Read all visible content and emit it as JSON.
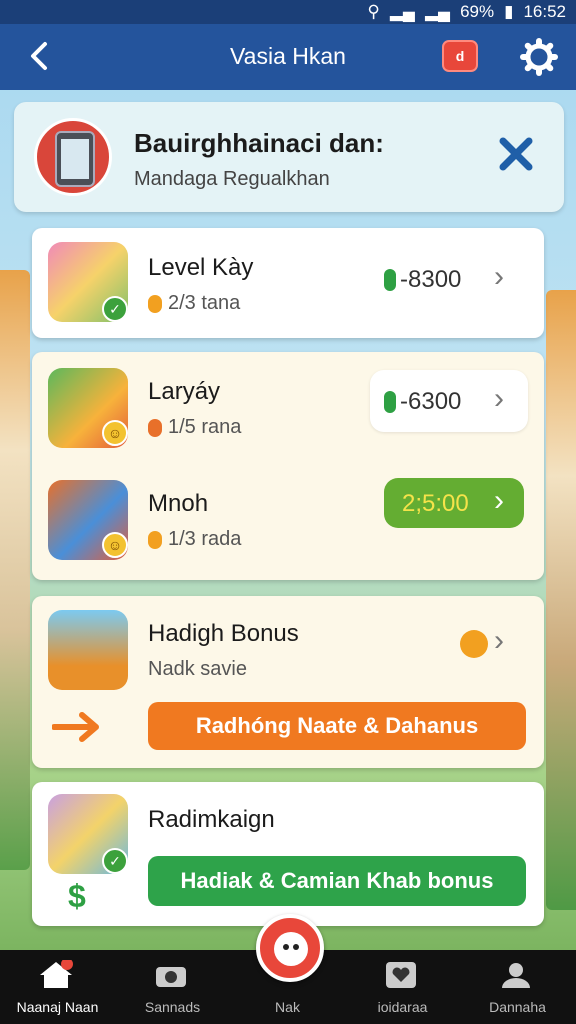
{
  "status_bar": {
    "battery": "69%",
    "time": "16:52"
  },
  "app_bar": {
    "title": "Vasia Hkan",
    "notification_badge": "d"
  },
  "header": {
    "title": "Bauirghhainaci dan:",
    "subtitle": "Mandaga Regualkhan"
  },
  "rows": [
    {
      "title": "Level Kày",
      "sub": "2/3 tana",
      "value": "-8300"
    },
    {
      "title": "Laryáy",
      "sub": "1/5 rana",
      "value": "-6300"
    },
    {
      "title": "Mnoh",
      "sub": "1/3 rada",
      "value": "2;5:00"
    }
  ],
  "bonus": {
    "title": "Hadigh Bonus",
    "sub": "Nadk savie",
    "button": "Radhóng Naate & Dahanus"
  },
  "campaign": {
    "title": "Radimkaign",
    "button": "Hadiak & Camian  Khab bonus",
    "dollar": "$"
  },
  "nav": [
    {
      "label": "Naanaj Naan",
      "icon": "home-icon"
    },
    {
      "label": "Sannads",
      "icon": "camera-icon"
    },
    {
      "label": "Nak",
      "icon": "face-icon"
    },
    {
      "label": "ioidaraa",
      "icon": "heart-box-icon"
    },
    {
      "label": "Dannaha",
      "icon": "profile-icon"
    }
  ],
  "colors": {
    "appbar": "#24549c",
    "accent_green": "#2ea043",
    "accent_orange": "#f07920",
    "accent_red": "#e8473a"
  }
}
